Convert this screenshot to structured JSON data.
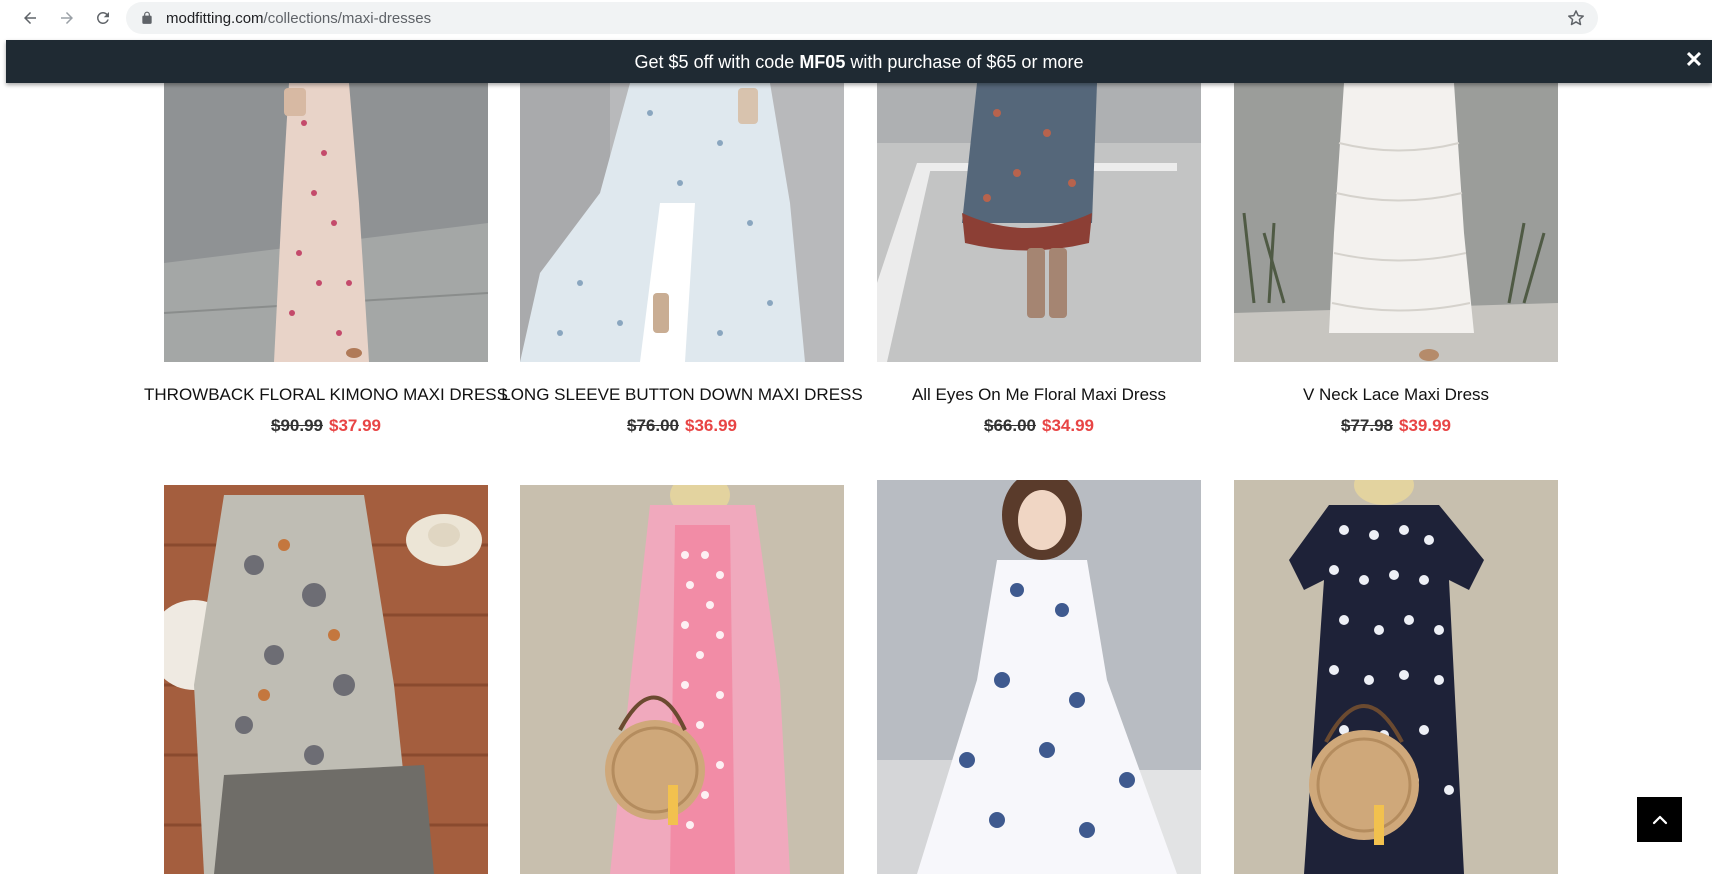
{
  "browser": {
    "url_domain": "modfitting.com",
    "url_path": "/collections/maxi-dresses"
  },
  "promo": {
    "text_before": "Get $5 off with code ",
    "code": "MF05",
    "text_after": " with purchase of $65 or more",
    "close_symbol": "✕"
  },
  "products": [
    {
      "title": "THROWBACK FLORAL KIMONO MAXI DRESS",
      "old_price": "$90.99",
      "new_price": "$37.99"
    },
    {
      "title": "LONG SLEEVE BUTTON DOWN MAXI DRESS",
      "old_price": "$76.00",
      "new_price": "$36.99"
    },
    {
      "title": "All Eyes On Me Floral Maxi Dress",
      "old_price": "$66.00",
      "new_price": "$34.99"
    },
    {
      "title": "V Neck Lace Maxi Dress",
      "old_price": "$77.98",
      "new_price": "$39.99"
    }
  ],
  "colors": {
    "promo_bg": "#1f2a33",
    "sale_price": "#e84545",
    "back_to_top_bg": "#000000"
  },
  "icons": {
    "back": "arrow-left-icon",
    "forward": "arrow-right-icon",
    "reload": "reload-icon",
    "lock": "lock-icon",
    "bookmark": "star-icon",
    "scroll_top": "chevron-up-icon"
  }
}
